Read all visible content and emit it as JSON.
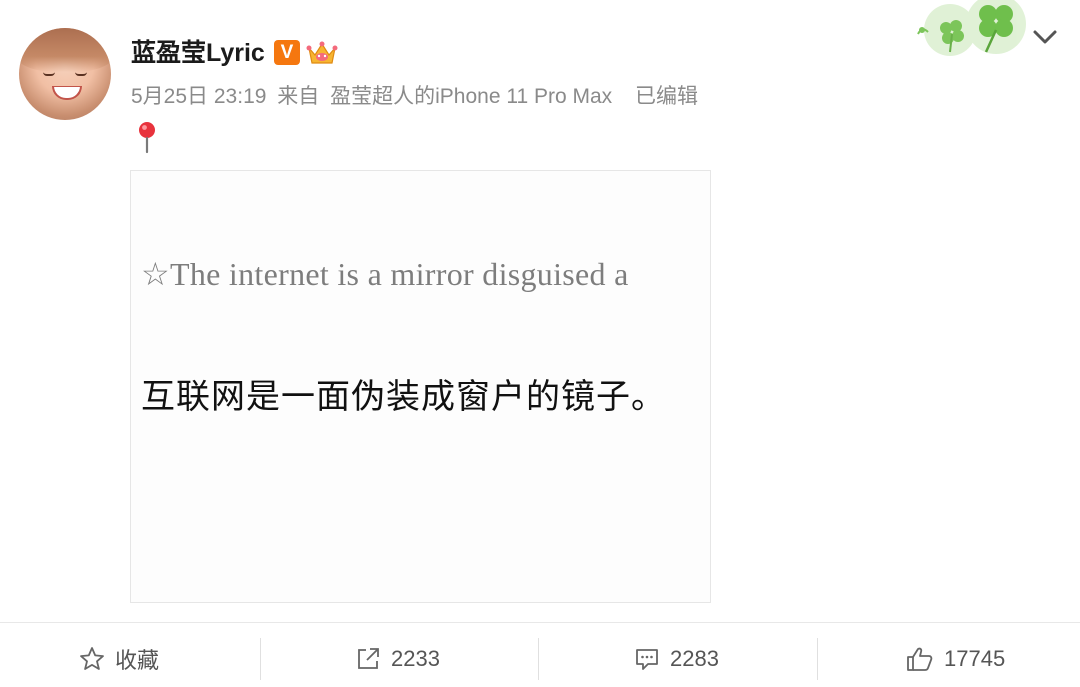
{
  "post": {
    "author": "蓝盈莹Lyric",
    "verified_badge": "V",
    "date": "5月25日 23:19",
    "from_prefix": "来自",
    "source": "盈莹超人的iPhone 11 Pro Max",
    "edited": "已编辑",
    "image": {
      "quote_en": "☆The internet is a mirror disguised a",
      "quote_zh": "互联网是一面伪装成窗户的镜子。"
    }
  },
  "actions": {
    "favorite_label": "收藏",
    "repost_count": "2233",
    "comment_count": "2283",
    "like_count": "17745"
  },
  "icons": {
    "favorite": "star-outline-icon",
    "repost": "share-arrow-icon",
    "comment": "comment-bubble-icon",
    "like": "thumbs-up-icon",
    "more": "chevron-down-icon",
    "location": "location-pin-icon",
    "decoration": "clover-icon",
    "member": "crown-icon"
  },
  "colors": {
    "badge_orange": "#f5770f",
    "meta_gray": "#8a8a8a",
    "clover_green": "#7cc55a"
  }
}
